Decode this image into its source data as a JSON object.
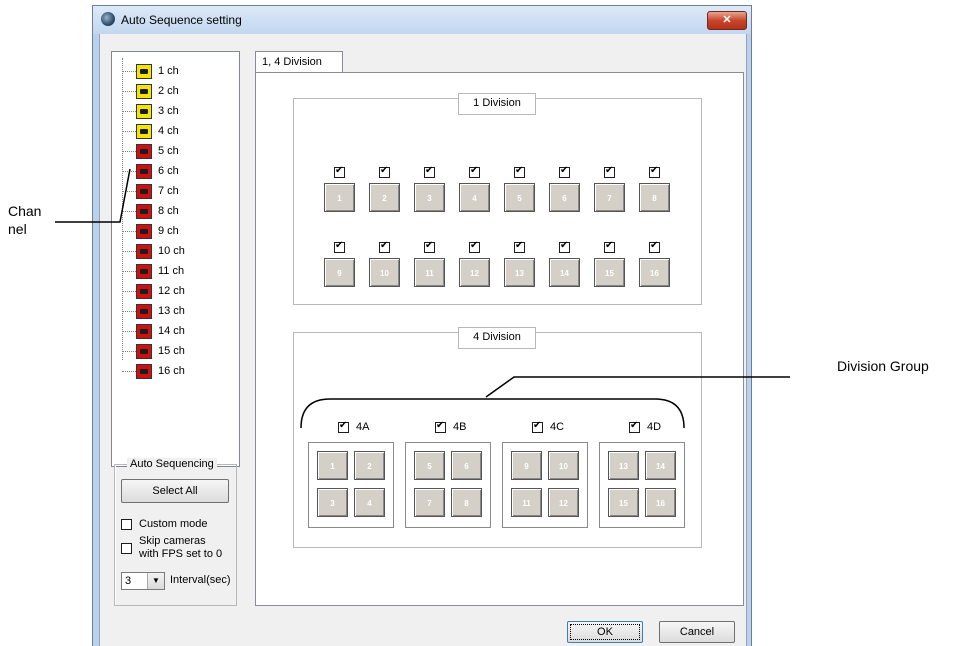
{
  "window": {
    "title": "Auto Sequence setting",
    "close_glyph": "✕"
  },
  "tree": {
    "items": [
      {
        "label": "1 ch",
        "state": "on"
      },
      {
        "label": "2 ch",
        "state": "on"
      },
      {
        "label": "3 ch",
        "state": "on"
      },
      {
        "label": "4 ch",
        "state": "on"
      },
      {
        "label": "5 ch",
        "state": "off"
      },
      {
        "label": "6 ch",
        "state": "off"
      },
      {
        "label": "7 ch",
        "state": "off"
      },
      {
        "label": "8 ch",
        "state": "off"
      },
      {
        "label": "9 ch",
        "state": "off"
      },
      {
        "label": "10 ch",
        "state": "off"
      },
      {
        "label": "11 ch",
        "state": "off"
      },
      {
        "label": "12 ch",
        "state": "off"
      },
      {
        "label": "13 ch",
        "state": "off"
      },
      {
        "label": "14 ch",
        "state": "off"
      },
      {
        "label": "15 ch",
        "state": "off"
      },
      {
        "label": "16 ch",
        "state": "off"
      }
    ]
  },
  "auto_sequencing": {
    "title": "Auto Sequencing",
    "select_all_label": "Select All",
    "custom_mode_label": "Custom mode",
    "custom_mode_checked": false,
    "skip_label_line1": "Skip cameras",
    "skip_label_line2": "with FPS set to 0",
    "skip_checked": false,
    "interval_value": "3",
    "interval_label": "Interval(sec)"
  },
  "tab": {
    "label": "1, 4 Division"
  },
  "division1": {
    "title": "1 Division",
    "channels": [
      "1",
      "2",
      "3",
      "4",
      "5",
      "6",
      "7",
      "8",
      "9",
      "10",
      "11",
      "12",
      "13",
      "14",
      "15",
      "16"
    ],
    "checked": [
      true,
      true,
      true,
      true,
      true,
      true,
      true,
      true,
      true,
      true,
      true,
      true,
      true,
      true,
      true,
      true
    ]
  },
  "division4": {
    "title": "4 Division",
    "groups": [
      {
        "label": "4A",
        "checked": true,
        "channels": [
          "1",
          "2",
          "3",
          "4"
        ]
      },
      {
        "label": "4B",
        "checked": true,
        "channels": [
          "5",
          "6",
          "7",
          "8"
        ]
      },
      {
        "label": "4C",
        "checked": true,
        "channels": [
          "9",
          "10",
          "11",
          "12"
        ]
      },
      {
        "label": "4D",
        "checked": true,
        "channels": [
          "13",
          "14",
          "15",
          "16"
        ]
      }
    ]
  },
  "footer": {
    "ok_label": "OK",
    "cancel_label": "Cancel"
  },
  "annotations": {
    "channel_line1": "Chan",
    "channel_line2": "nel",
    "division_group": "Division Group"
  },
  "colors": {
    "camera_on": "#f2e600",
    "camera_off": "#d01010"
  }
}
